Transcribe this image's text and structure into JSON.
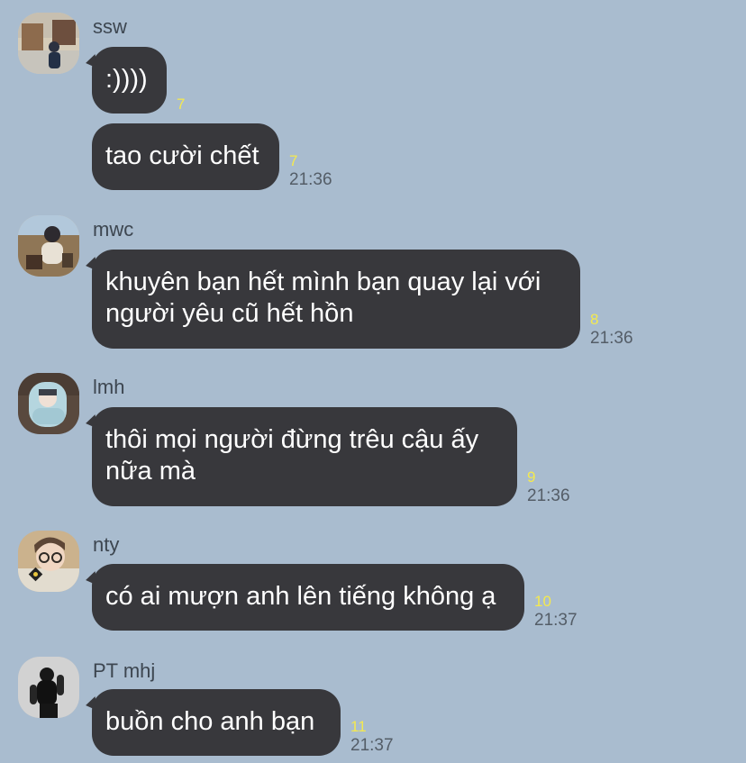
{
  "messages": [
    {
      "sender": "ssw",
      "avatar_icon": "profile-photo-ssw",
      "bubbles": [
        {
          "text": ":))))",
          "unread": "7",
          "time": ""
        },
        {
          "text": "tao cười chết",
          "unread": "7",
          "time": "21:36"
        }
      ]
    },
    {
      "sender": "mwc",
      "avatar_icon": "profile-photo-mwc",
      "bubbles": [
        {
          "text": "khuyên bạn hết mình bạn quay lại với người yêu cũ hết hồn",
          "unread": "8",
          "time": "21:36"
        }
      ]
    },
    {
      "sender": "lmh",
      "avatar_icon": "profile-photo-lmh",
      "bubbles": [
        {
          "text": "thôi mọi người đừng trêu cậu ấy nữa mà",
          "unread": "9",
          "time": "21:36"
        }
      ]
    },
    {
      "sender": "nty",
      "avatar_icon": "profile-photo-nty",
      "bubbles": [
        {
          "text": "có ai mượn anh lên tiếng không ạ",
          "unread": "10",
          "time": "21:37"
        }
      ]
    },
    {
      "sender": "PT mhj",
      "avatar_icon": "profile-photo-pt-mhj",
      "bubbles": [
        {
          "text": "buồn cho anh bạn",
          "unread": "11",
          "time": "21:37"
        }
      ]
    }
  ],
  "colors": {
    "background": "#a9bccf",
    "bubble": "#38383c",
    "bubble_text": "#ffffff",
    "unread": "#f4e94f",
    "time": "#545d67",
    "sender": "#3d4650"
  }
}
